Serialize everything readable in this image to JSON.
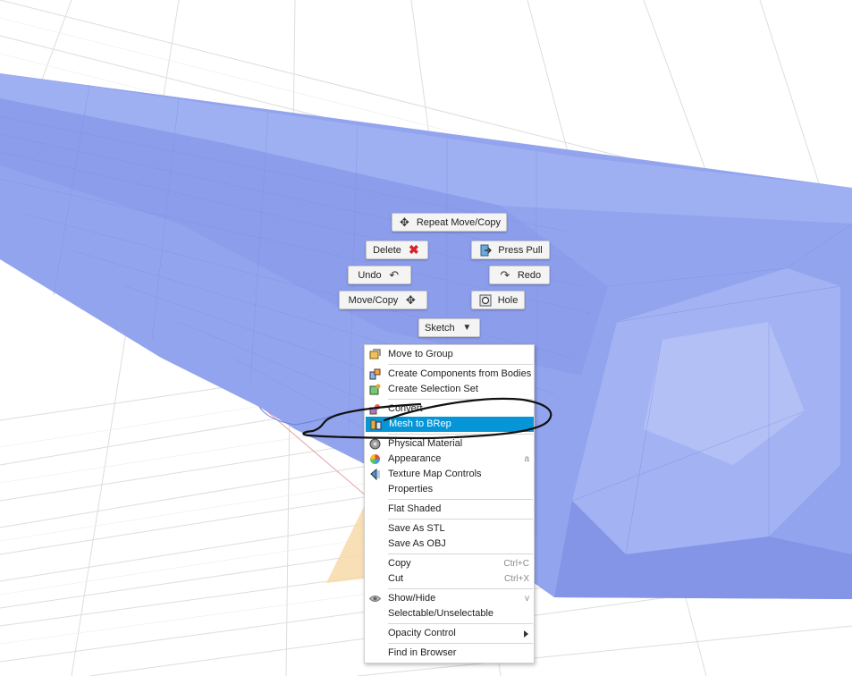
{
  "marking_menu": {
    "repeat": "Repeat Move/Copy",
    "delete": "Delete",
    "press_pull": "Press Pull",
    "undo": "Undo",
    "redo": "Redo",
    "move_copy": "Move/Copy",
    "hole": "Hole",
    "sketch": "Sketch"
  },
  "context_menu": {
    "items": [
      {
        "label": "Move to Group",
        "shortcut": "",
        "icon": "move-to-group-icon"
      },
      {
        "label": "Create Components from Bodies",
        "shortcut": "",
        "icon": "components-icon"
      },
      {
        "label": "Create Selection Set",
        "shortcut": "",
        "icon": "selection-set-icon"
      },
      {
        "label": "Convert",
        "shortcut": "",
        "icon": "convert-icon"
      },
      {
        "label": "Mesh to BRep",
        "shortcut": "",
        "icon": "mesh-to-brep-icon",
        "highlighted": true
      },
      {
        "label": "Physical Material",
        "shortcut": "",
        "icon": "physical-material-icon"
      },
      {
        "label": "Appearance",
        "shortcut": "a",
        "icon": "appearance-icon"
      },
      {
        "label": "Texture Map Controls",
        "shortcut": "",
        "icon": "texture-map-icon"
      },
      {
        "label": "Properties",
        "shortcut": "",
        "icon": ""
      },
      {
        "label": "Flat Shaded",
        "shortcut": "",
        "icon": ""
      },
      {
        "label": "Save As STL",
        "shortcut": "",
        "icon": ""
      },
      {
        "label": "Save As OBJ",
        "shortcut": "",
        "icon": ""
      },
      {
        "label": "Copy",
        "shortcut": "Ctrl+C",
        "icon": ""
      },
      {
        "label": "Cut",
        "shortcut": "Ctrl+X",
        "icon": ""
      },
      {
        "label": "Show/Hide",
        "shortcut": "v",
        "icon": "eye-icon"
      },
      {
        "label": "Selectable/Unselectable",
        "shortcut": "",
        "icon": ""
      },
      {
        "label": "Opacity Control",
        "shortcut": "",
        "icon": ""
      },
      {
        "label": "Find in Browser",
        "shortcut": "",
        "icon": ""
      }
    ]
  },
  "colors": {
    "mesh": "#93a4ee",
    "highlight": "#0696d7",
    "grid": "#dcdcdc",
    "axis_red": "#e8a0a0"
  }
}
